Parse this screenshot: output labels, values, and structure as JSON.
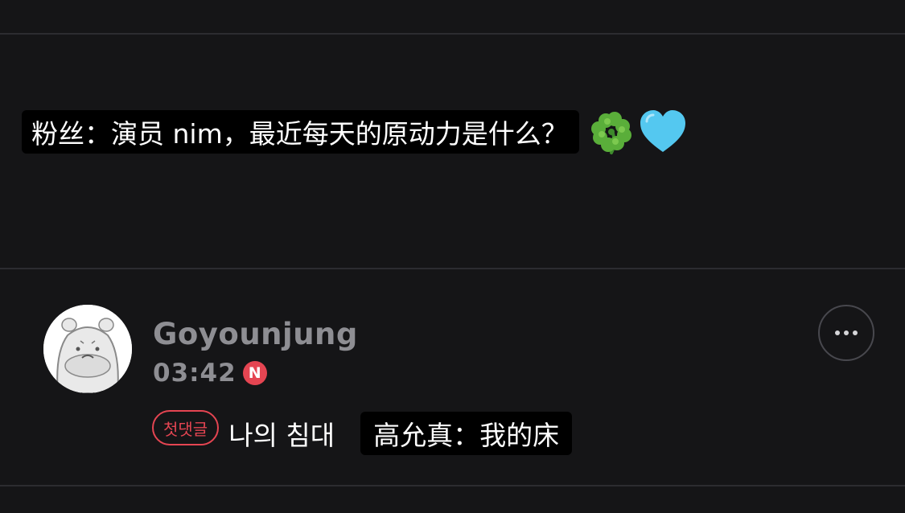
{
  "post": {
    "caption": "粉丝：演员 nim，最近每天的原动力是什么？",
    "emojis": [
      "four-leaf-clover-icon",
      "light-blue-heart-icon"
    ]
  },
  "comment": {
    "username": "Goyounjung",
    "time": "03:42",
    "new_badge": "N",
    "first_comment_badge": "첫댓글",
    "text": "나의 침대",
    "caption": "高允真：我的床"
  },
  "colors": {
    "background": "#151517",
    "divider": "#2c2c30",
    "muted_text": "#8e8e93",
    "accent_red": "#e54552",
    "caption_bg": "#000000"
  }
}
